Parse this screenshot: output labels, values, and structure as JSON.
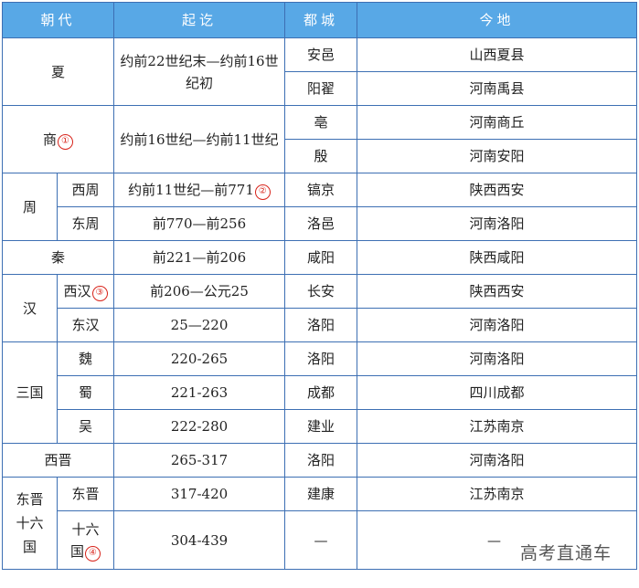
{
  "header": {
    "dynasty": "朝代",
    "period": "起讫",
    "capital": "都城",
    "today": "今地"
  },
  "rows": {
    "xia": {
      "name": "夏",
      "period": "约前22世纪末—约前16世纪初",
      "capitals": [
        {
          "city": "安邑",
          "today": "山西夏县"
        },
        {
          "city": "阳翟",
          "today": "河南禹县"
        }
      ]
    },
    "shang": {
      "name": "商",
      "note": "①",
      "period": "约前16世纪—约前11世纪",
      "capitals": [
        {
          "city": "亳",
          "today": "河南商丘"
        },
        {
          "city": "殷",
          "today": "河南安阳"
        }
      ]
    },
    "zhou": {
      "name": "周",
      "sub": [
        {
          "name": "西周",
          "period": "约前11世纪—前771",
          "note": "②",
          "city": "镐京",
          "today": "陕西西安"
        },
        {
          "name": "东周",
          "period": "前770—前256",
          "city": "洛邑",
          "today": "河南洛阳"
        }
      ]
    },
    "qin": {
      "name": "秦",
      "period": "前221—前206",
      "city": "咸阳",
      "today": "陕西咸阳"
    },
    "han": {
      "name": "汉",
      "sub": [
        {
          "name": "西汉",
          "note": "③",
          "period": "前206—公元25",
          "city": "长安",
          "today": "陕西西安"
        },
        {
          "name": "东汉",
          "period": "25—220",
          "city": "洛阳",
          "today": "河南洛阳"
        }
      ]
    },
    "sanguo": {
      "name": "三国",
      "sub": [
        {
          "name": "魏",
          "period": "220-265",
          "city": "洛阳",
          "today": "河南洛阳"
        },
        {
          "name": "蜀",
          "period": "221-263",
          "city": "成都",
          "today": "四川成都"
        },
        {
          "name": "吴",
          "period": "222-280",
          "city": "建业",
          "today": "江苏南京"
        }
      ]
    },
    "xijin": {
      "name": "西晋",
      "period": "265-317",
      "city": "洛阳",
      "today": "河南洛阳"
    },
    "dongjin": {
      "name": "东晋十六国",
      "sub": [
        {
          "name": "东晋",
          "period": "317-420",
          "city": "建康",
          "today": "江苏南京"
        },
        {
          "name": "十六国",
          "note": "④",
          "period": "304-439",
          "city": "—",
          "today": "—"
        }
      ]
    }
  },
  "watermark": "高考直通车"
}
